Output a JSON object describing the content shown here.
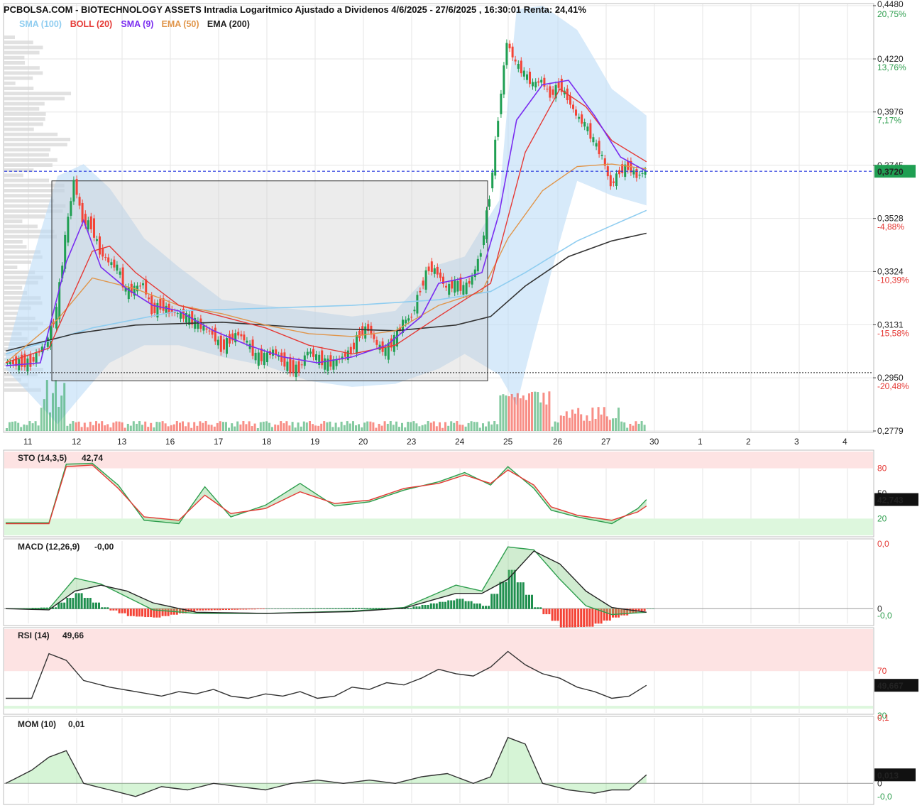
{
  "title": "PCBOLSA.COM - BIOTECHNOLOGY ASSETS Intradia Logaritmico Ajustado a Dividenos 4/6/2025 - 27/6/2025 , 16:30:01 Renta: 24,41%",
  "colors": {
    "up": "#1f9f52",
    "down": "#f44336",
    "sma100": "#8fcdf0",
    "boll": "#e53935",
    "sma9": "#7a2df0",
    "ema50": "#e0954a",
    "ema200": "#333333",
    "bandfill": "#bcdcf7",
    "currentline": "#2233dd"
  },
  "legend": [
    {
      "label": "SMA (100)",
      "color": "#8fcdf0"
    },
    {
      "label": "BOLL (20)",
      "color": "#e53935"
    },
    {
      "label": "SMA (9)",
      "color": "#7a2df0"
    },
    {
      "label": "EMA (50)",
      "color": "#e0954a"
    },
    {
      "label": "EMA (200)",
      "color": "#222222"
    }
  ],
  "price_axis": {
    "ticks": [
      "0,4480",
      "0,4220",
      "0,3976",
      "0,3745",
      "0,3528",
      "0,3324",
      "0,3131",
      "0,2950",
      "0,2779"
    ],
    "pct": [
      "20,75%",
      "13,76%",
      "7,17%",
      "",
      "-4,88%",
      "-10,39%",
      "-15,58%",
      "-20,48%",
      ""
    ],
    "current": "0,3720"
  },
  "x_labels": [
    "11",
    "12",
    "13",
    "16",
    "17",
    "18",
    "19",
    "20",
    "23",
    "24",
    "25",
    "26",
    "27",
    "30",
    "1",
    "2",
    "3",
    "4"
  ],
  "panels": {
    "sto": {
      "label": "STO (14,3,5)",
      "value": "42,74",
      "current": "42,743",
      "ticks": [
        "80",
        "50",
        "20"
      ]
    },
    "macd": {
      "label": "MACD (12,26,9)",
      "value": "-0,00",
      "ticks": [
        "0,0",
        "0",
        "-0,0"
      ]
    },
    "rsi": {
      "label": "RSI (14)",
      "value": "49,66",
      "current": "49,667",
      "ticks": [
        "70",
        "30"
      ]
    },
    "mom": {
      "label": "MOM (10)",
      "value": "0,01",
      "current": "0,013",
      "ticks": [
        "0,1",
        "0",
        "-0,0"
      ]
    }
  },
  "chart_data": {
    "type": "line",
    "scale": "log",
    "ylim": [
      0.2779,
      0.448
    ],
    "x_category_labels": [
      "11",
      "12",
      "13",
      "16",
      "17",
      "18",
      "19",
      "20",
      "23",
      "24",
      "25",
      "26",
      "27",
      "30",
      "1",
      "2",
      "3",
      "4"
    ],
    "price_path": [
      [
        0,
        0.3
      ],
      [
        3,
        0.3
      ],
      [
        5,
        0.308
      ],
      [
        6,
        0.318
      ],
      [
        7,
        0.345
      ],
      [
        8,
        0.368
      ],
      [
        9,
        0.352
      ],
      [
        10,
        0.35
      ],
      [
        11,
        0.34
      ],
      [
        12,
        0.336
      ],
      [
        13,
        0.334
      ],
      [
        14,
        0.325
      ],
      [
        15,
        0.326
      ],
      [
        16,
        0.328
      ],
      [
        17,
        0.318
      ],
      [
        18,
        0.32
      ],
      [
        19,
        0.318
      ],
      [
        20,
        0.317
      ],
      [
        21,
        0.316
      ],
      [
        22,
        0.314
      ],
      [
        23,
        0.312
      ],
      [
        24,
        0.31
      ],
      [
        25,
        0.305
      ],
      [
        26,
        0.308
      ],
      [
        27,
        0.31
      ],
      [
        28,
        0.307
      ],
      [
        29,
        0.302
      ],
      [
        30,
        0.302
      ],
      [
        31,
        0.304
      ],
      [
        32,
        0.301
      ],
      [
        33,
        0.298
      ],
      [
        34,
        0.298
      ],
      [
        35,
        0.304
      ],
      [
        36,
        0.302
      ],
      [
        37,
        0.3
      ],
      [
        38,
        0.3
      ],
      [
        39,
        0.302
      ],
      [
        40,
        0.304
      ],
      [
        41,
        0.31
      ],
      [
        42,
        0.312
      ],
      [
        43,
        0.306
      ],
      [
        44,
        0.304
      ],
      [
        45,
        0.308
      ],
      [
        46,
        0.314
      ],
      [
        47,
        0.316
      ],
      [
        48,
        0.326
      ],
      [
        49,
        0.334
      ],
      [
        50,
        0.332
      ],
      [
        51,
        0.326
      ],
      [
        52,
        0.328
      ],
      [
        53,
        0.326
      ],
      [
        54,
        0.33
      ],
      [
        55,
        0.34
      ],
      [
        56,
        0.362
      ],
      [
        57,
        0.395
      ],
      [
        58,
        0.43
      ],
      [
        59,
        0.42
      ],
      [
        60,
        0.415
      ],
      [
        61,
        0.41
      ],
      [
        62,
        0.412
      ],
      [
        63,
        0.405
      ],
      [
        64,
        0.41
      ],
      [
        65,
        0.404
      ],
      [
        66,
        0.396
      ],
      [
        67,
        0.392
      ],
      [
        68,
        0.385
      ],
      [
        69,
        0.378
      ],
      [
        70,
        0.366
      ],
      [
        71,
        0.372
      ],
      [
        72,
        0.374
      ],
      [
        73,
        0.37
      ],
      [
        74,
        0.372
      ]
    ],
    "sma100": [
      [
        0,
        0.303
      ],
      [
        10,
        0.312
      ],
      [
        20,
        0.318
      ],
      [
        30,
        0.319
      ],
      [
        40,
        0.32
      ],
      [
        50,
        0.322
      ],
      [
        56,
        0.325
      ],
      [
        60,
        0.332
      ],
      [
        66,
        0.344
      ],
      [
        70,
        0.35
      ],
      [
        74,
        0.356
      ]
    ],
    "ema200": [
      [
        0,
        0.304
      ],
      [
        8,
        0.31
      ],
      [
        15,
        0.313
      ],
      [
        25,
        0.314
      ],
      [
        35,
        0.312
      ],
      [
        45,
        0.311
      ],
      [
        52,
        0.313
      ],
      [
        56,
        0.316
      ],
      [
        60,
        0.327
      ],
      [
        65,
        0.338
      ],
      [
        70,
        0.344
      ],
      [
        74,
        0.347
      ]
    ],
    "ema50": [
      [
        0,
        0.3
      ],
      [
        6,
        0.315
      ],
      [
        10,
        0.33
      ],
      [
        15,
        0.326
      ],
      [
        20,
        0.32
      ],
      [
        25,
        0.317
      ],
      [
        30,
        0.313
      ],
      [
        35,
        0.31
      ],
      [
        40,
        0.309
      ],
      [
        45,
        0.311
      ],
      [
        50,
        0.32
      ],
      [
        55,
        0.325
      ],
      [
        58,
        0.345
      ],
      [
        62,
        0.364
      ],
      [
        66,
        0.374
      ],
      [
        70,
        0.375
      ],
      [
        74,
        0.373
      ]
    ],
    "boll_mid": [
      [
        0,
        0.3
      ],
      [
        5,
        0.305
      ],
      [
        10,
        0.34
      ],
      [
        12,
        0.342
      ],
      [
        15,
        0.332
      ],
      [
        20,
        0.32
      ],
      [
        25,
        0.316
      ],
      [
        30,
        0.312
      ],
      [
        35,
        0.306
      ],
      [
        40,
        0.303
      ],
      [
        45,
        0.306
      ],
      [
        50,
        0.316
      ],
      [
        53,
        0.322
      ],
      [
        56,
        0.328
      ],
      [
        60,
        0.38
      ],
      [
        64,
        0.408
      ],
      [
        67,
        0.4
      ],
      [
        70,
        0.385
      ],
      [
        74,
        0.376
      ]
    ],
    "boll_upper": [
      [
        0,
        0.302
      ],
      [
        6,
        0.37
      ],
      [
        9,
        0.375
      ],
      [
        12,
        0.365
      ],
      [
        16,
        0.345
      ],
      [
        20,
        0.334
      ],
      [
        25,
        0.322
      ],
      [
        30,
        0.32
      ],
      [
        35,
        0.318
      ],
      [
        40,
        0.316
      ],
      [
        45,
        0.318
      ],
      [
        50,
        0.335
      ],
      [
        53,
        0.338
      ],
      [
        57,
        0.36
      ],
      [
        59,
        0.446
      ],
      [
        62,
        0.448
      ],
      [
        66,
        0.436
      ],
      [
        70,
        0.408
      ],
      [
        74,
        0.396
      ]
    ],
    "boll_lower": [
      [
        0,
        0.298
      ],
      [
        6,
        0.28
      ],
      [
        9,
        0.29
      ],
      [
        12,
        0.3
      ],
      [
        16,
        0.306
      ],
      [
        20,
        0.306
      ],
      [
        25,
        0.302
      ],
      [
        30,
        0.299
      ],
      [
        35,
        0.294
      ],
      [
        40,
        0.292
      ],
      [
        45,
        0.293
      ],
      [
        50,
        0.298
      ],
      [
        53,
        0.303
      ],
      [
        57,
        0.296
      ],
      [
        59,
        0.286
      ],
      [
        62,
        0.32
      ],
      [
        66,
        0.368
      ],
      [
        70,
        0.362
      ],
      [
        74,
        0.358
      ]
    ],
    "sma9": [
      [
        0,
        0.299
      ],
      [
        4,
        0.3
      ],
      [
        7,
        0.336
      ],
      [
        9,
        0.352
      ],
      [
        11,
        0.334
      ],
      [
        14,
        0.326
      ],
      [
        17,
        0.32
      ],
      [
        20,
        0.318
      ],
      [
        24,
        0.311
      ],
      [
        28,
        0.306
      ],
      [
        32,
        0.302
      ],
      [
        36,
        0.3
      ],
      [
        40,
        0.302
      ],
      [
        44,
        0.306
      ],
      [
        48,
        0.316
      ],
      [
        50,
        0.328
      ],
      [
        53,
        0.33
      ],
      [
        55,
        0.332
      ],
      [
        57,
        0.355
      ],
      [
        59,
        0.394
      ],
      [
        62,
        0.41
      ],
      [
        65,
        0.412
      ],
      [
        68,
        0.396
      ],
      [
        71,
        0.378
      ],
      [
        74,
        0.372
      ]
    ],
    "consolidation_box": {
      "from": 5,
      "to": 55,
      "high": 0.368,
      "low": 0.294
    },
    "support_line": 0.2967,
    "sto_k": [
      [
        0,
        15
      ],
      [
        5,
        15
      ],
      [
        7,
        85
      ],
      [
        10,
        86
      ],
      [
        13,
        60
      ],
      [
        16,
        18
      ],
      [
        20,
        14
      ],
      [
        23,
        58
      ],
      [
        26,
        22
      ],
      [
        30,
        36
      ],
      [
        34,
        62
      ],
      [
        38,
        35
      ],
      [
        42,
        40
      ],
      [
        46,
        54
      ],
      [
        50,
        64
      ],
      [
        53,
        75
      ],
      [
        56,
        60
      ],
      [
        58,
        82
      ],
      [
        61,
        56
      ],
      [
        63,
        30
      ],
      [
        66,
        22
      ],
      [
        70,
        14
      ],
      [
        73,
        32
      ],
      [
        74,
        42.74
      ]
    ],
    "sto_d": [
      [
        0,
        14
      ],
      [
        5,
        14
      ],
      [
        7,
        82
      ],
      [
        10,
        84
      ],
      [
        13,
        56
      ],
      [
        16,
        22
      ],
      [
        20,
        18
      ],
      [
        23,
        48
      ],
      [
        26,
        26
      ],
      [
        30,
        32
      ],
      [
        34,
        52
      ],
      [
        38,
        38
      ],
      [
        42,
        42
      ],
      [
        46,
        56
      ],
      [
        50,
        62
      ],
      [
        53,
        72
      ],
      [
        56,
        62
      ],
      [
        58,
        78
      ],
      [
        61,
        60
      ],
      [
        63,
        34
      ],
      [
        66,
        24
      ],
      [
        70,
        18
      ],
      [
        73,
        28
      ],
      [
        74,
        35
      ]
    ],
    "macd_line": [
      [
        0,
        0
      ],
      [
        5,
        0
      ],
      [
        8,
        0.52
      ],
      [
        11,
        0.42
      ],
      [
        14,
        0.2
      ],
      [
        17,
        -0.02
      ],
      [
        22,
        -0.08
      ],
      [
        30,
        -0.08
      ],
      [
        40,
        -0.04
      ],
      [
        46,
        0.02
      ],
      [
        52,
        0.4
      ],
      [
        55,
        0.3
      ],
      [
        58,
        1.05
      ],
      [
        61,
        1.0
      ],
      [
        64,
        0.5
      ],
      [
        67,
        0.05
      ],
      [
        70,
        -0.1
      ],
      [
        74,
        -0.06
      ]
    ],
    "macd_signal": [
      [
        0,
        0
      ],
      [
        5,
        -0.02
      ],
      [
        8,
        0.3
      ],
      [
        11,
        0.4
      ],
      [
        14,
        0.3
      ],
      [
        17,
        0.1
      ],
      [
        22,
        -0.06
      ],
      [
        30,
        -0.08
      ],
      [
        40,
        -0.05
      ],
      [
        46,
        0.01
      ],
      [
        52,
        0.26
      ],
      [
        55,
        0.26
      ],
      [
        58,
        0.5
      ],
      [
        61,
        0.98
      ],
      [
        64,
        0.76
      ],
      [
        67,
        0.3
      ],
      [
        70,
        0.02
      ],
      [
        74,
        -0.06
      ]
    ],
    "rsi": [
      [
        0,
        38
      ],
      [
        3,
        38
      ],
      [
        5,
        78
      ],
      [
        7,
        72
      ],
      [
        9,
        54
      ],
      [
        12,
        48
      ],
      [
        15,
        44
      ],
      [
        18,
        40
      ],
      [
        20,
        44
      ],
      [
        22,
        42
      ],
      [
        24,
        46
      ],
      [
        26,
        40
      ],
      [
        28,
        38
      ],
      [
        30,
        42
      ],
      [
        32,
        40
      ],
      [
        34,
        44
      ],
      [
        36,
        38
      ],
      [
        38,
        40
      ],
      [
        40,
        48
      ],
      [
        42,
        46
      ],
      [
        44,
        52
      ],
      [
        46,
        50
      ],
      [
        48,
        56
      ],
      [
        50,
        64
      ],
      [
        52,
        60
      ],
      [
        54,
        58
      ],
      [
        56,
        66
      ],
      [
        58,
        80
      ],
      [
        60,
        68
      ],
      [
        62,
        60
      ],
      [
        64,
        56
      ],
      [
        66,
        48
      ],
      [
        68,
        44
      ],
      [
        70,
        38
      ],
      [
        72,
        40
      ],
      [
        74,
        49.67
      ]
    ],
    "mom": [
      [
        0,
        0
      ],
      [
        3,
        0.02
      ],
      [
        5,
        0.04
      ],
      [
        7,
        0.05
      ],
      [
        9,
        0.0
      ],
      [
        12,
        -0.01
      ],
      [
        15,
        -0.02
      ],
      [
        18,
        -0.005
      ],
      [
        21,
        -0.01
      ],
      [
        24,
        0.0
      ],
      [
        27,
        -0.005
      ],
      [
        30,
        -0.01
      ],
      [
        33,
        0.0
      ],
      [
        36,
        0.005
      ],
      [
        39,
        0.0
      ],
      [
        42,
        0.005
      ],
      [
        45,
        0.0
      ],
      [
        48,
        0.01
      ],
      [
        51,
        0.015
      ],
      [
        54,
        0.0
      ],
      [
        56,
        0.01
      ],
      [
        58,
        0.07
      ],
      [
        60,
        0.06
      ],
      [
        62,
        0.0
      ],
      [
        65,
        -0.01
      ],
      [
        68,
        -0.015
      ],
      [
        70,
        -0.01
      ],
      [
        72,
        -0.01
      ],
      [
        74,
        0.013
      ]
    ]
  }
}
